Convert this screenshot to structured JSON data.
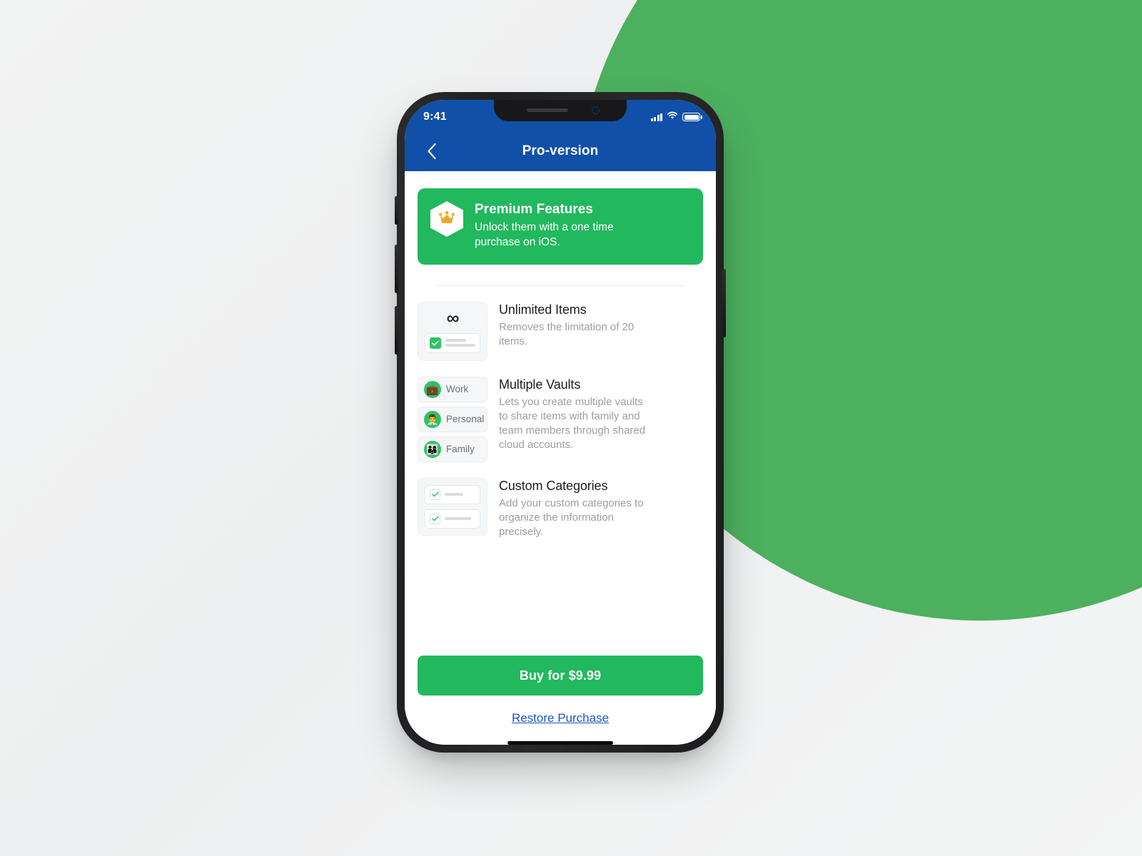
{
  "status_bar": {
    "time": "9:41",
    "icons": [
      "signal-icon",
      "wifi-icon",
      "battery-icon"
    ]
  },
  "navbar": {
    "back_icon": "chevron-left-icon",
    "title": "Pro-version"
  },
  "hero": {
    "badge_icon": "crown-icon",
    "title": "Premium Features",
    "subtitle": "Unlock them with a one time purchase on iOS."
  },
  "features": [
    {
      "thumb_type": "unlimited",
      "thumb_glyph": "∞",
      "title": "Unlimited Items",
      "description": "Removes the limitation of 20 items."
    },
    {
      "thumb_type": "vaults",
      "vaults": [
        {
          "label": "Work",
          "icon": "briefcase-icon",
          "glyph": "💼"
        },
        {
          "label": "Personal",
          "icon": "businessman-icon",
          "glyph": "👨‍💼"
        },
        {
          "label": "Family",
          "icon": "family-icon",
          "glyph": "👨‍👩‍👦"
        }
      ],
      "title": "Multiple Vaults",
      "description": "Lets you create multiple vaults to share items with family and team members through shared cloud accounts."
    },
    {
      "thumb_type": "categories",
      "title": "Custom Categories",
      "description": "Add your custom categories to organize the information precisely."
    }
  ],
  "footer": {
    "buy_label": "Buy for $9.99",
    "restore_label": "Restore Purchase"
  },
  "colors": {
    "navbar_blue": "#1150A8",
    "accent_green": "#22B85E",
    "blob_green": "#4CB05F",
    "link_blue": "#1A56C4",
    "page_background": "#F1F2F3"
  }
}
